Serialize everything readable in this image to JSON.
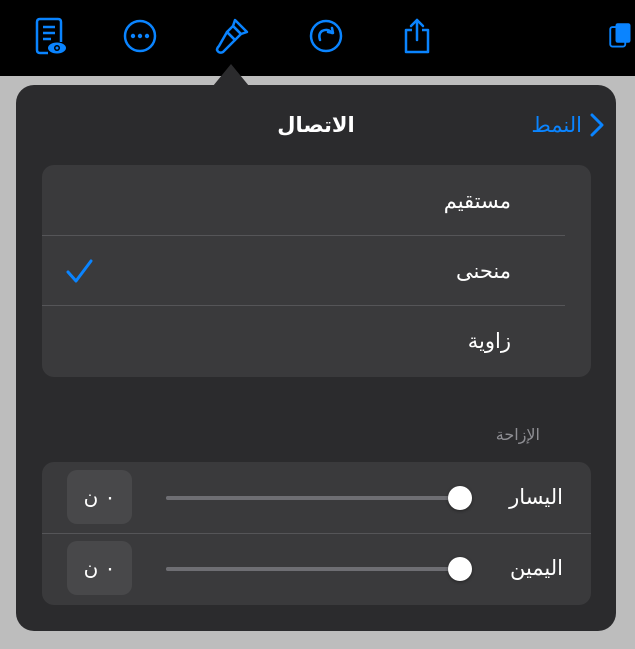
{
  "colors": {
    "accent": "#0a84ff",
    "popover_bg": "#2b2b2d",
    "group_bg": "#3a3a3c"
  },
  "toolbar": {
    "icons": [
      "document-eye-icon",
      "more-icon",
      "format-brush-icon",
      "redo-icon",
      "share-icon",
      "copy-icon"
    ]
  },
  "popover": {
    "title": "الاتصال",
    "back_label": "النمط"
  },
  "connection_style": {
    "items": [
      {
        "label": "مستقيم",
        "selected": false
      },
      {
        "label": "منحنى",
        "selected": true
      },
      {
        "label": "زاوية",
        "selected": false
      }
    ]
  },
  "offset": {
    "section_label": "الإزاحة",
    "rows": [
      {
        "label": "اليسار",
        "value": "٠ ن",
        "slider_fraction": 1.0
      },
      {
        "label": "اليمين",
        "value": "٠ ن",
        "slider_fraction": 1.0
      }
    ]
  }
}
